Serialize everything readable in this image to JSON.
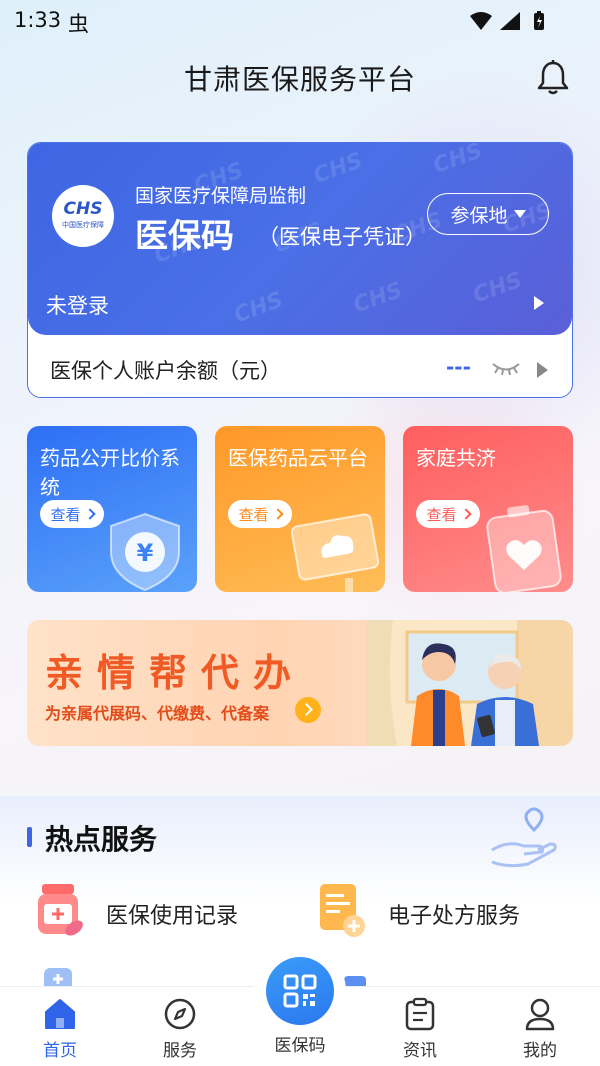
{
  "status_bar": {
    "time": "1:33",
    "app_icon": "虫"
  },
  "header": {
    "title": "甘肃医保服务平台"
  },
  "code_card": {
    "supervise_text": "国家医疗保障局监制",
    "title": "医保码",
    "subtitle": "（医保电子凭证）",
    "logo_text": "CHS",
    "logo_sub": "中国医疗保障",
    "region_button": "参保地",
    "login_status": "未登录",
    "balance_label": "医保个人账户余额（元）",
    "balance_value": "---"
  },
  "features": [
    {
      "title": "药品公开比价系统",
      "button": "查看",
      "icon": "yen-shield-icon"
    },
    {
      "title": "医保药品云平台",
      "button": "查看",
      "icon": "cloud-monitor-icon"
    },
    {
      "title": "家庭共济",
      "button": "查看",
      "icon": "heart-battery-icon"
    }
  ],
  "banner": {
    "title": "亲情帮代办",
    "subtitle": "为亲属代展码、代缴费、代备案"
  },
  "hot_services": {
    "title": "热点服务",
    "items": [
      {
        "label": "医保使用记录",
        "icon": "medicine-bottle-icon"
      },
      {
        "label": "电子处方服务",
        "icon": "prescription-icon"
      }
    ]
  },
  "bottom_nav": {
    "items": [
      {
        "label": "首页",
        "icon": "home-icon"
      },
      {
        "label": "服务",
        "icon": "compass-icon"
      },
      {
        "label": "医保码",
        "icon": "qr-code-icon"
      },
      {
        "label": "资讯",
        "icon": "clipboard-icon"
      },
      {
        "label": "我的",
        "icon": "user-icon"
      }
    ]
  },
  "colors": {
    "primary": "#3e66e4",
    "orange": "#ff9828",
    "red": "#ff5e5e",
    "nav_active": "#2f63e8"
  }
}
